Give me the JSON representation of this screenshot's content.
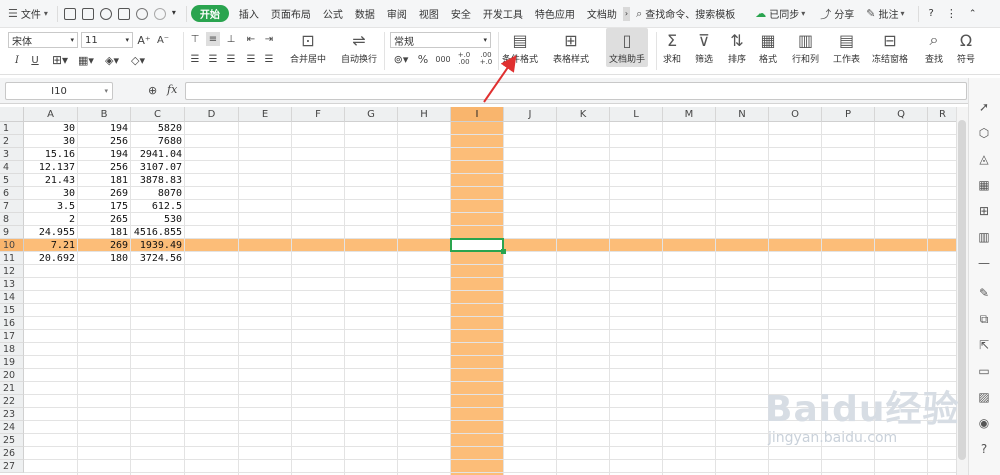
{
  "menu": {
    "file_label": "文件",
    "tabs": [
      "开始",
      "插入",
      "页面布局",
      "公式",
      "数据",
      "审阅",
      "视图",
      "安全",
      "开发工具",
      "特色应用",
      "文档助"
    ],
    "active_tab": "开始",
    "search_label": "查找命令、搜索模板",
    "sync_label": "已同步",
    "share_label": "分享",
    "comment_label": "批注",
    "help_label": "?"
  },
  "ribbon": {
    "font_name": "宋体",
    "font_size": "11",
    "number_format": "常规",
    "merge_center": "合并居中",
    "auto_wrap": "自动换行",
    "cond_format": "条件格式",
    "table_style": "表格样式",
    "doc_assistant": "文档助手",
    "sum": "求和",
    "filter": "筛选",
    "sort": "排序",
    "format": "格式",
    "rows_cols": "行和列",
    "worksheet": "工作表",
    "freeze": "冻结窗格",
    "find": "查找",
    "symbol": "符号",
    "percent": "%",
    "thousands": "000",
    "inc_decimal": "+.0 .00",
    "dec_decimal": ".00 +.0"
  },
  "formula_bar": {
    "name_box": "I10",
    "fx_label": "fx",
    "zoom_icon": "magnifier-icon",
    "content": ""
  },
  "columns": [
    "A",
    "B",
    "C",
    "D",
    "E",
    "F",
    "G",
    "H",
    "I",
    "J",
    "K",
    "L",
    "M",
    "N",
    "O",
    "P",
    "Q",
    "R"
  ],
  "selected_column": "I",
  "selected_row": 10,
  "row_numbers": [
    "1",
    "2",
    "3",
    "4",
    "5",
    "6",
    "7",
    "8",
    "9",
    "10",
    "11",
    "12",
    "13",
    "14",
    "15",
    "16",
    "17",
    "18",
    "19",
    "20",
    "21",
    "22",
    "23",
    "24",
    "25",
    "26",
    "27"
  ],
  "cells": [
    [
      "30",
      "194",
      "5820"
    ],
    [
      "30",
      "256",
      "7680"
    ],
    [
      "15.16",
      "194",
      "2941.04"
    ],
    [
      "12.137",
      "256",
      "3107.07"
    ],
    [
      "21.43",
      "181",
      "3878.83"
    ],
    [
      "30",
      "269",
      "8070"
    ],
    [
      "3.5",
      "175",
      "612.5"
    ],
    [
      "2",
      "265",
      "530"
    ],
    [
      "24.955",
      "181",
      "4516.855"
    ],
    [
      "7.21",
      "269",
      "1939.49"
    ],
    [
      "20.692",
      "180",
      "3724.56"
    ]
  ],
  "colors": {
    "accent": "#2aa44f",
    "highlight": "#fcbd78",
    "arrow": "#e03030"
  },
  "watermark": {
    "brand": "Baidu经验",
    "url": "jingyan.baidu.com"
  }
}
